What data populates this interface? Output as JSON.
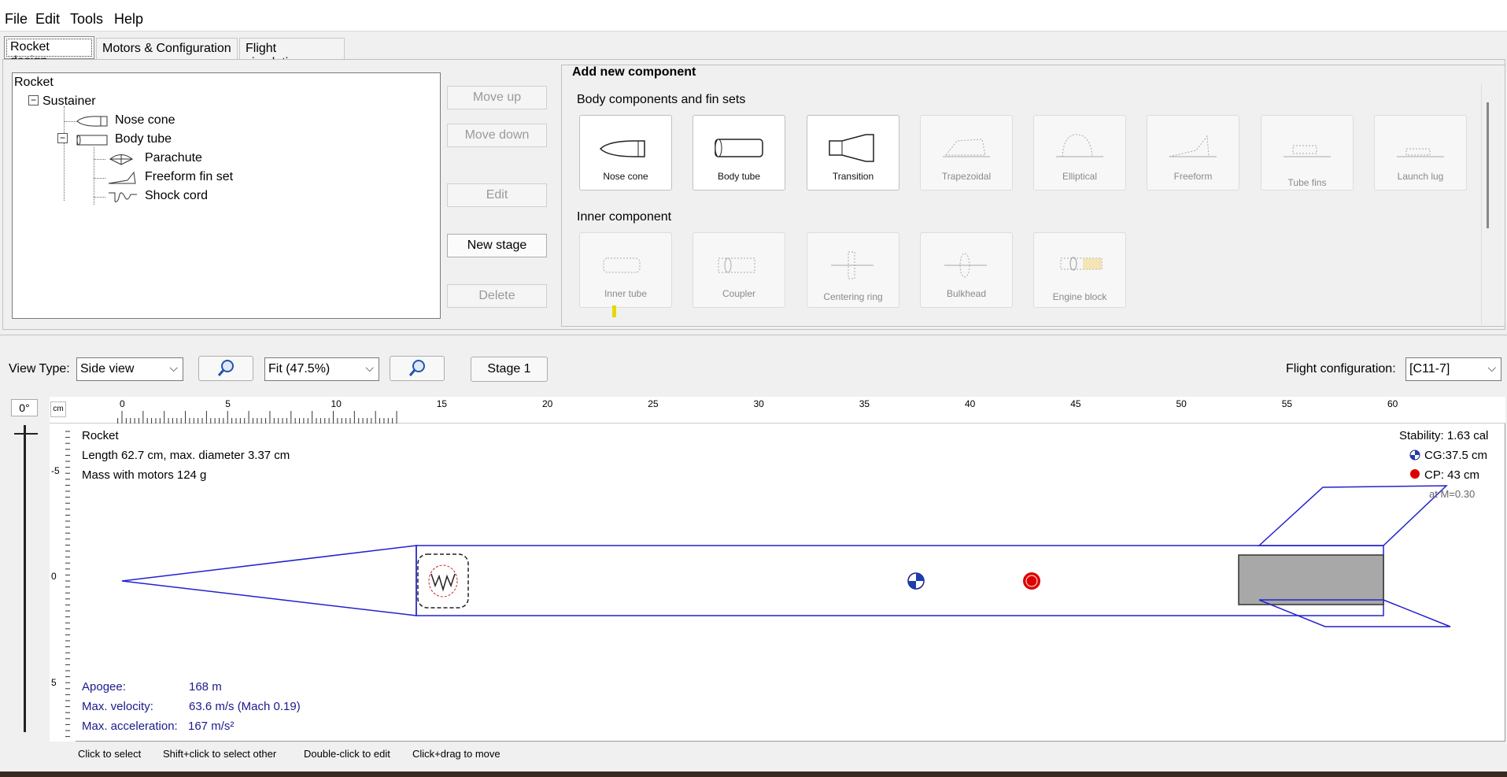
{
  "menu": {
    "items": [
      "File",
      "Edit",
      "Tools",
      "Help"
    ]
  },
  "tabs": [
    "Rocket design",
    "Motors & Configuration",
    "Flight simulations"
  ],
  "tree": {
    "root": "Rocket",
    "stage": "Sustainer",
    "items": [
      "Nose cone",
      "Body tube",
      "Parachute",
      "Freeform fin set",
      "Shock cord"
    ]
  },
  "side_buttons": {
    "move_up": "Move up",
    "move_down": "Move down",
    "edit": "Edit",
    "new_stage": "New stage",
    "delete": "Delete"
  },
  "add_component": {
    "title": "Add new component",
    "body_section": "Body components and fin sets",
    "body_items": [
      "Nose cone",
      "Body tube",
      "Transition",
      "Trapezoidal",
      "Elliptical",
      "Freeform",
      "Tube fins",
      "Launch lug"
    ],
    "inner_section": "Inner component",
    "inner_items": [
      "Inner tube",
      "Coupler",
      "Centering ring",
      "Bulkhead",
      "Engine block"
    ]
  },
  "toolbar": {
    "view_type_label": "View Type:",
    "view_type_value": "Side view",
    "zoom_value": "Fit (47.5%)",
    "stage_button": "Stage 1",
    "flight_config_label": "Flight configuration:",
    "flight_config_value": "[C11-7]"
  },
  "view": {
    "angle": "0°",
    "unit": "cm",
    "h_ticks": [
      "0",
      "5",
      "10",
      "15",
      "20",
      "25",
      "30",
      "35",
      "40",
      "45",
      "50",
      "55",
      "60"
    ],
    "v_ticks": [
      "-5",
      "0",
      "5"
    ]
  },
  "rocket_info": {
    "name": "Rocket",
    "length": "Length 62.7 cm, max. diameter 3.37 cm",
    "mass": "Mass with motors 124 g",
    "stability": "Stability: 1.63 cal",
    "cg": "CG:37.5 cm",
    "cp": "CP:   43 cm",
    "mach": "at M=0.30"
  },
  "flight_info": {
    "apogee_label": "Apogee:",
    "apogee_value": "168 m",
    "velocity_label": "Max. velocity:",
    "velocity_value": "63.6 m/s  (Mach 0.19)",
    "accel_label": "Max. acceleration:",
    "accel_value": "167 m/s²"
  },
  "status_bar": {
    "select": "Click to select",
    "select_other": "Shift+click to select other",
    "edit": "Double-click to edit",
    "move": "Click+drag to move"
  },
  "colors": {
    "outline": "#2222cc",
    "cp": "#dd0000",
    "motor": "#a8a8a8",
    "flight_text": "#1a1a8c"
  }
}
